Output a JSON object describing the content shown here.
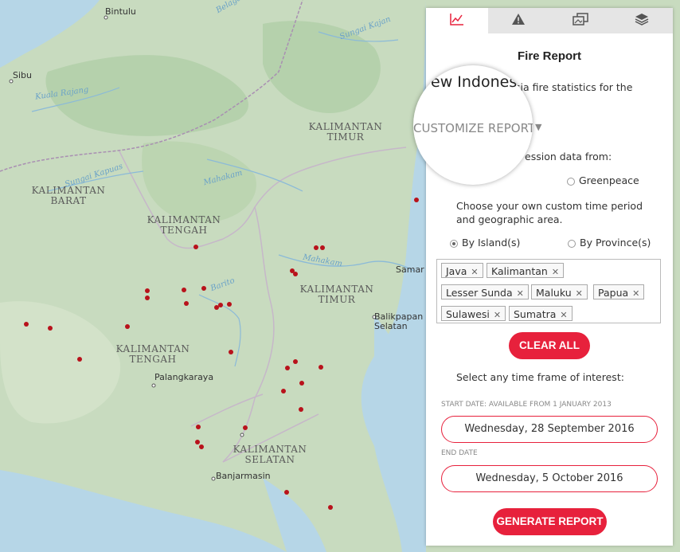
{
  "map": {
    "labels": {
      "kaltim_n": "KALIMANTAN\nTIMUR",
      "kalbar": "KALIMANTAN\nBARAT",
      "kalteng_n": "KALIMANTAN\nTENGAH",
      "kaltim_c": "KALIMANTAN\nTIMUR",
      "kalteng_s": "KALIMANTAN\nTENGAH",
      "kalsel": "KALIMANTAN\nSELATAN"
    },
    "cities": {
      "bintulu": "Bintulu",
      "sibu": "Sibu",
      "samarinda": "Samar",
      "balikpapan": "Balikpapan\nSelatan",
      "palangkaraya": "Palangkaraya",
      "banjarmasin": "Banjarmasin"
    },
    "rivers": {
      "kuala_rajang": "Kuala Rajang",
      "sungai_kajan": "Sungai Kajan",
      "sungai_kapuas": "Sungai Kapuas",
      "mahakam1": "Mahakam",
      "mahakam2": "Mahakam",
      "barito": "Barito",
      "belaga": "Belaga"
    }
  },
  "panel": {
    "tabs": [
      {
        "icon": "line-chart-icon",
        "active": true
      },
      {
        "icon": "warning-icon",
        "active": false
      },
      {
        "icon": "images-icon",
        "active": false
      },
      {
        "icon": "layers-icon",
        "active": false
      }
    ],
    "title": "Fire Report",
    "intro_text": "sia fire statistics for the",
    "magnifier_text_top": "ew Indonesi",
    "customize_label": "CUSTOMIZE REPORT",
    "concession_text": "ession data from:",
    "greenpeace_label": "Greenpeace",
    "choose_text_1": "Choose your own custom time period",
    "choose_text_2": "and geographic area.",
    "by_islands_label": "By Island(s)",
    "by_province_label": "By Province(s)",
    "islands": [
      "Java",
      "Kalimantan",
      "Lesser Sunda",
      "Maluku",
      "Papua",
      "Sulawesi",
      "Sumatra"
    ],
    "clear_all": "CLEAR ALL",
    "timeframe_text": "Select any time frame of interest:",
    "start_caption": "START DATE: AVAILABLE FROM 1 JANUARY 2013",
    "start_date": "Wednesday, 28 September 2016",
    "end_caption": "END DATE",
    "end_date": "Wednesday, 5 October 2016",
    "generate": "GENERATE REPORT",
    "accent_color": "#e7213c"
  }
}
